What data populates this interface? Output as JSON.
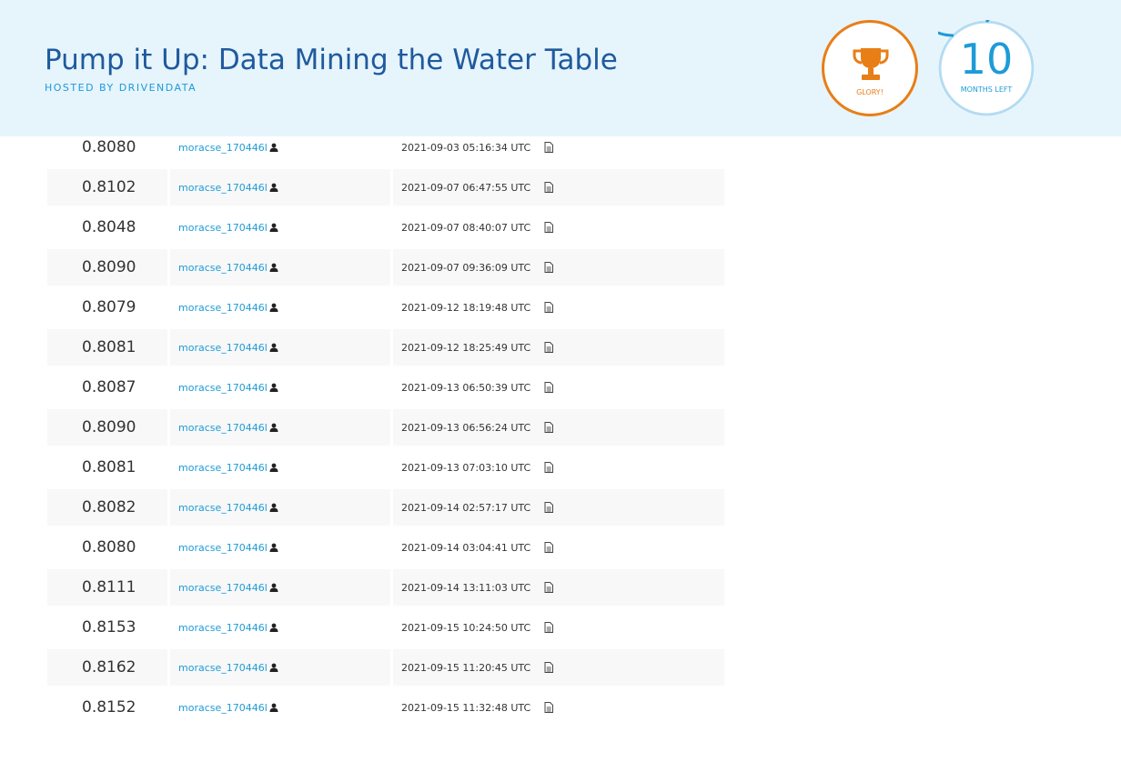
{
  "header": {
    "title": "Pump it Up: Data Mining the Water Table",
    "hosted_by": "HOSTED BY DRIVENDATA",
    "glory_label": "GLORY!",
    "months_value": "10",
    "months_label": "MONTHS LEFT",
    "colors": {
      "title": "#1f5a9e",
      "accent_blue": "#1e9bd7",
      "glory_orange": "#e87e16",
      "header_bg": "#e6f4fc"
    }
  },
  "submissions": [
    {
      "score": "0.8080",
      "user": "moracse_170446l",
      "timestamp": "2021-09-03 05:16:34 UTC"
    },
    {
      "score": "0.8102",
      "user": "moracse_170446l",
      "timestamp": "2021-09-07 06:47:55 UTC"
    },
    {
      "score": "0.8048",
      "user": "moracse_170446l",
      "timestamp": "2021-09-07 08:40:07 UTC"
    },
    {
      "score": "0.8090",
      "user": "moracse_170446l",
      "timestamp": "2021-09-07 09:36:09 UTC"
    },
    {
      "score": "0.8079",
      "user": "moracse_170446l",
      "timestamp": "2021-09-12 18:19:48 UTC"
    },
    {
      "score": "0.8081",
      "user": "moracse_170446l",
      "timestamp": "2021-09-12 18:25:49 UTC"
    },
    {
      "score": "0.8087",
      "user": "moracse_170446l",
      "timestamp": "2021-09-13 06:50:39 UTC"
    },
    {
      "score": "0.8090",
      "user": "moracse_170446l",
      "timestamp": "2021-09-13 06:56:24 UTC"
    },
    {
      "score": "0.8081",
      "user": "moracse_170446l",
      "timestamp": "2021-09-13 07:03:10 UTC"
    },
    {
      "score": "0.8082",
      "user": "moracse_170446l",
      "timestamp": "2021-09-14 02:57:17 UTC"
    },
    {
      "score": "0.8080",
      "user": "moracse_170446l",
      "timestamp": "2021-09-14 03:04:41 UTC"
    },
    {
      "score": "0.8111",
      "user": "moracse_170446l",
      "timestamp": "2021-09-14 13:11:03 UTC"
    },
    {
      "score": "0.8153",
      "user": "moracse_170446l",
      "timestamp": "2021-09-15 10:24:50 UTC"
    },
    {
      "score": "0.8162",
      "user": "moracse_170446l",
      "timestamp": "2021-09-15 11:20:45 UTC"
    },
    {
      "score": "0.8152",
      "user": "moracse_170446l",
      "timestamp": "2021-09-15 11:32:48 UTC"
    }
  ],
  "icons": {
    "user": "person-icon",
    "submission_file": "document-icon",
    "prize": "trophy-icon"
  }
}
